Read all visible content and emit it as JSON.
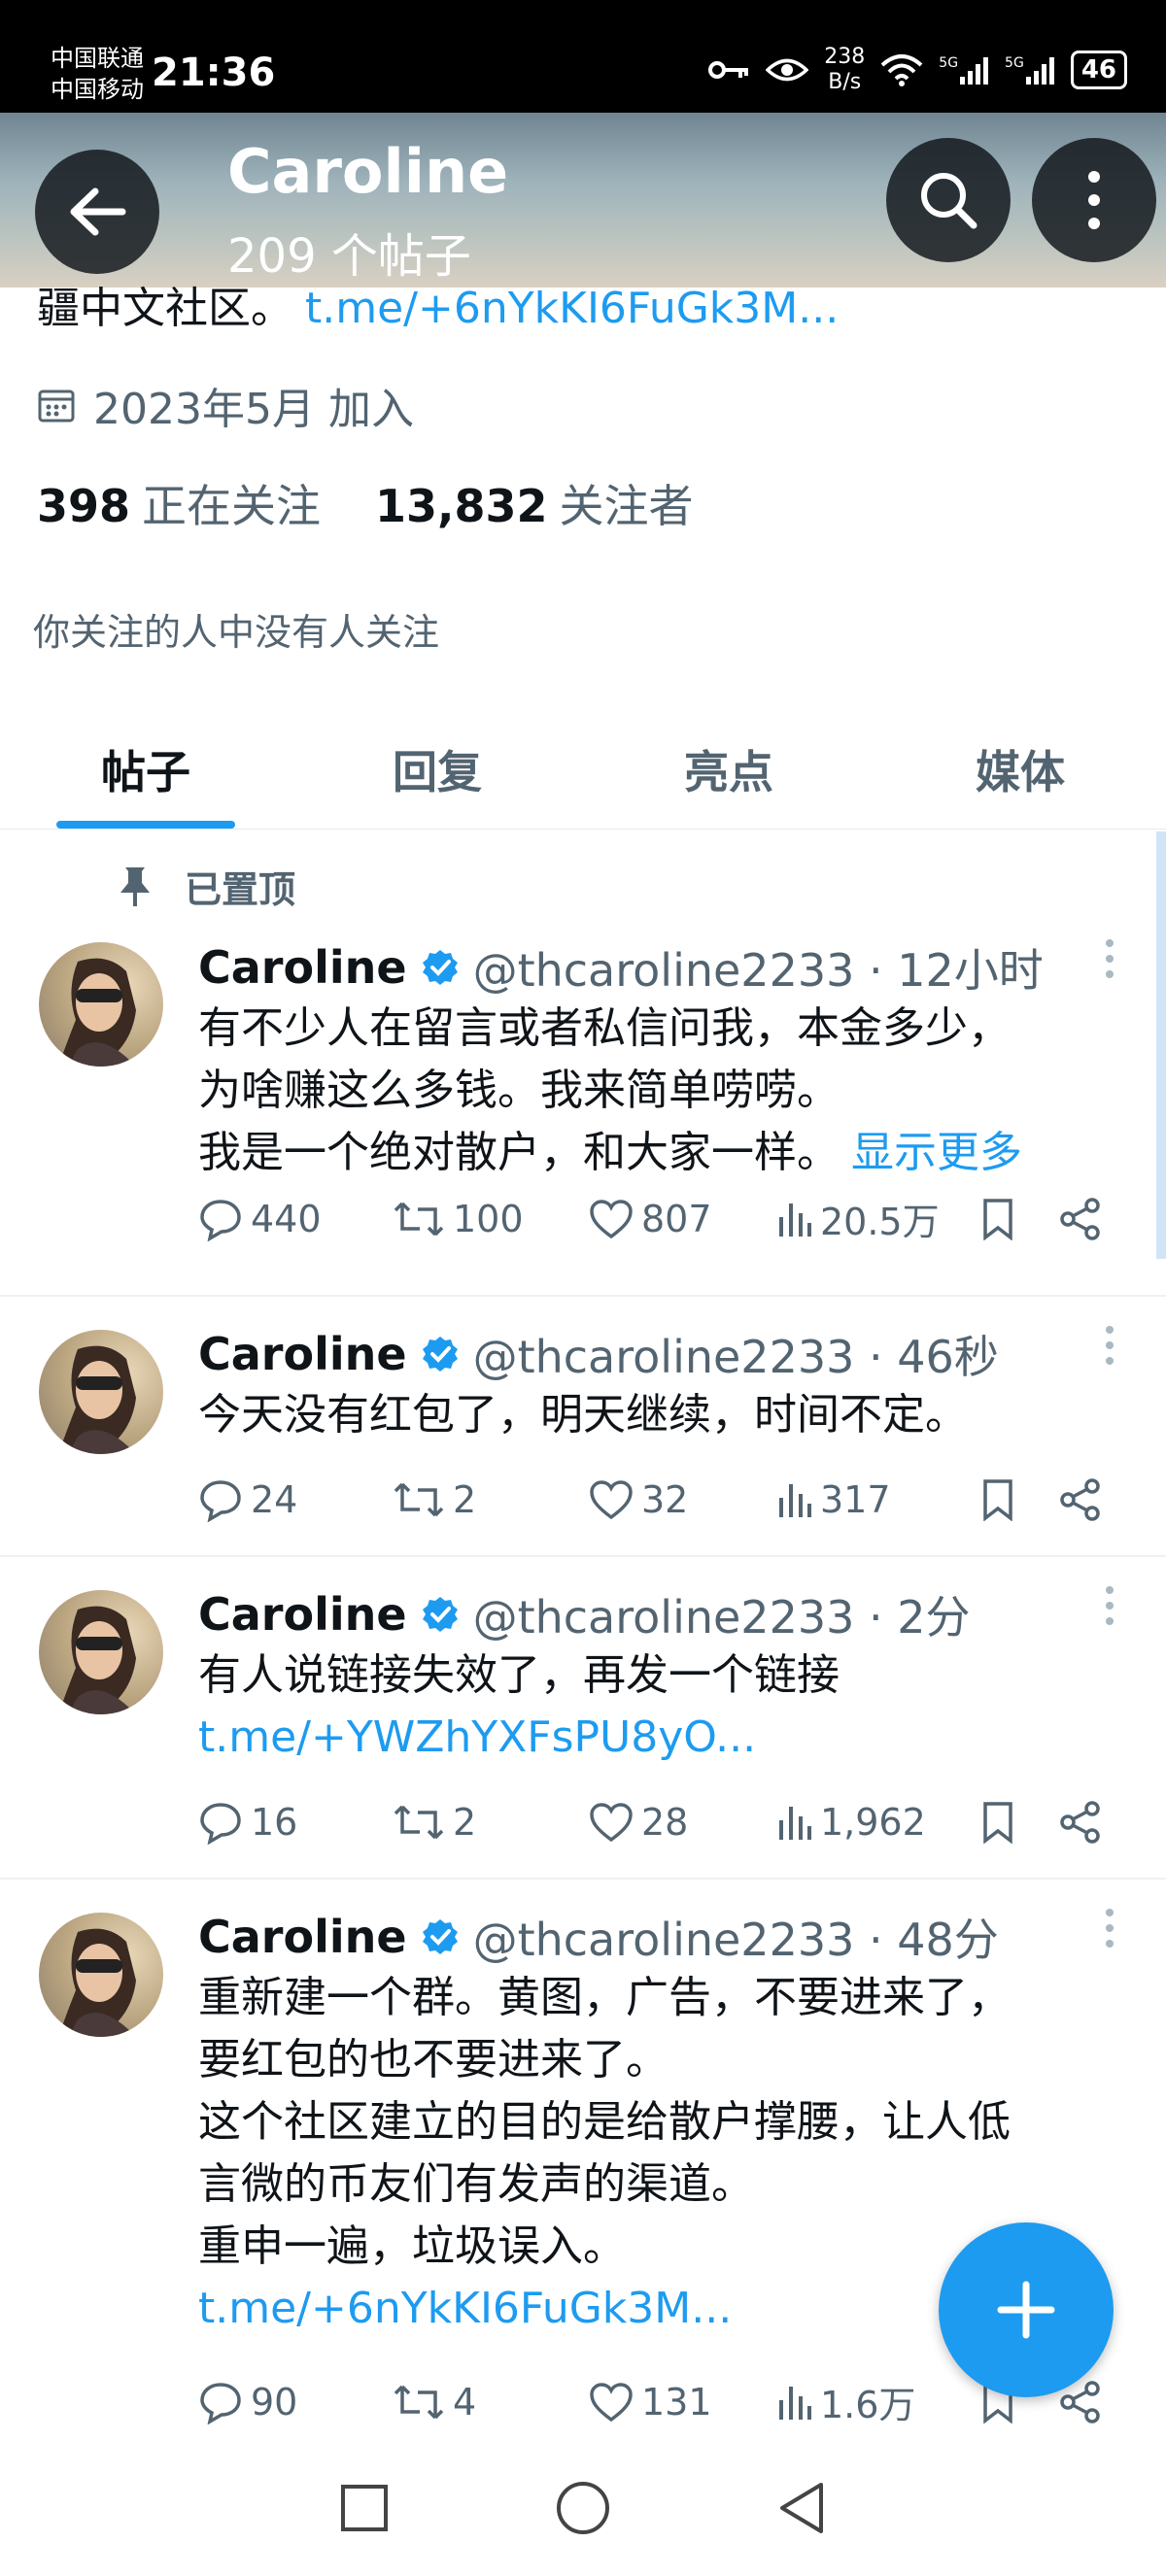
{
  "status_bar": {
    "carrier1": "中国联通",
    "carrier2": "中国移动",
    "time": "21:36",
    "netspeed_value": "238",
    "netspeed_unit": "B/s",
    "signal_label_1": "5G",
    "signal_label_2": "5G",
    "battery": "46"
  },
  "header": {
    "title": "Caroline",
    "subtitle": "209 个帖子"
  },
  "profile": {
    "bio_text": "疆中文社区。",
    "bio_link": "t.me/+6nYkKI6FuGk3M...",
    "joined": "2023年5月 加入",
    "following_count": "398",
    "following_label": "正在关注",
    "followers_count": "13,832",
    "followers_label": "关注者",
    "followed_by_note": "你关注的人中没有人关注"
  },
  "tabs": [
    {
      "label": "帖子",
      "active": true
    },
    {
      "label": "回复",
      "active": false
    },
    {
      "label": "亮点",
      "active": false
    },
    {
      "label": "媒体",
      "active": false
    }
  ],
  "pinned_label": "已置顶",
  "posts": [
    {
      "name": "Caroline",
      "handle": "@thcaroline2233 · 12小时",
      "line1": "有不少人在留言或者私信问我，本金多少，",
      "line2": "为啥赚这么多钱。我来简单唠唠。",
      "line3": "我是一个绝对散户，和大家一样。",
      "show_more": "显示更多",
      "replies": "440",
      "reposts": "100",
      "likes": "807",
      "views": "20.5万"
    },
    {
      "name": "Caroline",
      "handle": "@thcaroline2233 · 46秒",
      "line1": "今天没有红包了，明天继续，时间不定。",
      "replies": "24",
      "reposts": "2",
      "likes": "32",
      "views": "317"
    },
    {
      "name": "Caroline",
      "handle": "@thcaroline2233 · 2分",
      "line1": "有人说链接失效了，再发一个链接",
      "link": "t.me/+YWZhYXFsPU8yO...",
      "replies": "16",
      "reposts": "2",
      "likes": "28",
      "views": "1,962"
    },
    {
      "name": "Caroline",
      "handle": "@thcaroline2233 · 48分",
      "line1": "重新建一个群。黄图，广告，不要进来了，",
      "line2": "要红包的也不要进来了。",
      "line3": "这个社区建立的目的是给散户撑腰，让人低",
      "line4": "言微的币友们有发声的渠道。",
      "line5": "重申一遍，垃圾误入。",
      "link": "t.me/+6nYkKI6FuGk3M...",
      "replies": "90",
      "reposts": "4",
      "likes": "131",
      "views": "1.6万"
    }
  ],
  "colors": {
    "accent": "#1d9bf0",
    "text_secondary": "#536471"
  }
}
